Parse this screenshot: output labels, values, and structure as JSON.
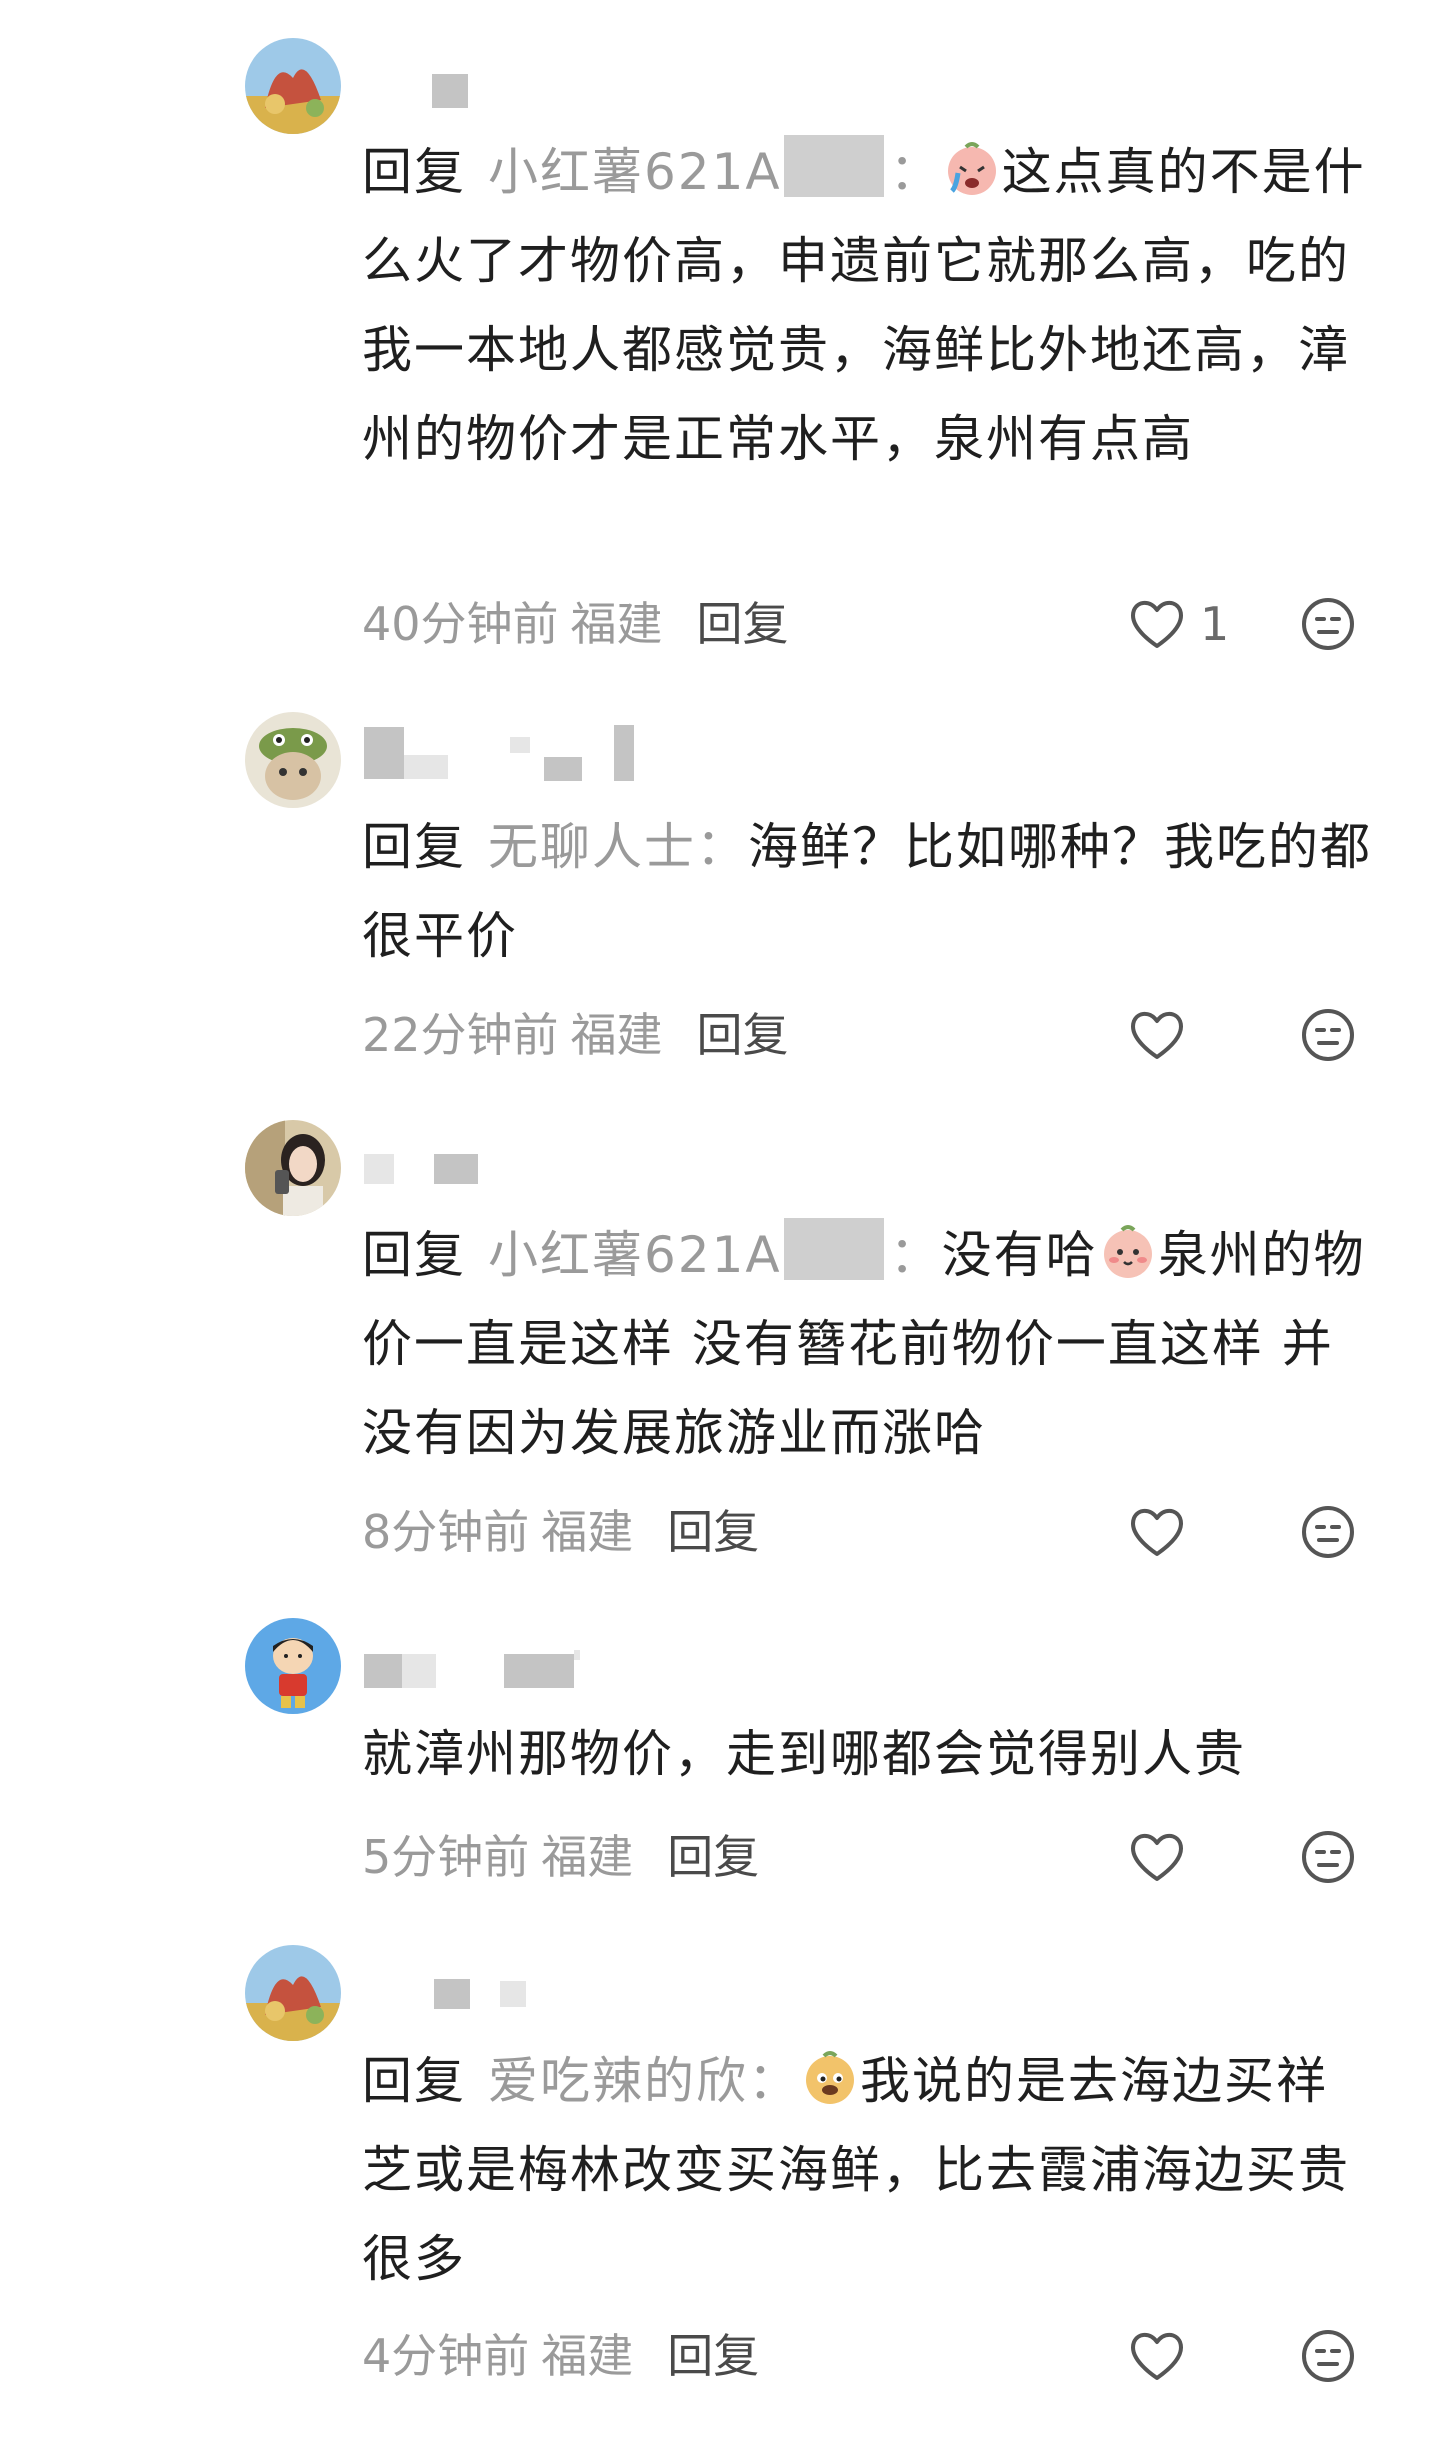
{
  "comments": [
    {
      "reply_label": "回复",
      "reply_target": "小红薯621A",
      "colon": "：",
      "text": "这点真的不是什么火了才物价高，申遗前它就那么高，吃的我一本地人都感觉贵，海鲜比外地还高，漳州的物价才是正常水平，泉州有点高",
      "emoji": "crying-face-icon",
      "time": "40分钟前",
      "region": "福建",
      "reply_button": "回复",
      "likes": "1"
    },
    {
      "reply_label": "回复",
      "reply_target": "无聊人士",
      "colon": "：",
      "text": "海鲜？比如哪种？我吃的都很平价",
      "time": "22分钟前",
      "region": "福建",
      "reply_button": "回复",
      "likes": ""
    },
    {
      "reply_label": "回复",
      "reply_target": "小红薯621A",
      "colon": "：",
      "text_before": "没有哈",
      "emoji": "shy-face-icon",
      "text": "泉州的物价一直是这样 没有簪花前物价一直这样 并没有因为发展旅游业而涨哈",
      "time": "8分钟前",
      "region": "福建",
      "reply_button": "回复",
      "likes": ""
    },
    {
      "text": "就漳州那物价，走到哪都会觉得别人贵",
      "time": "5分钟前",
      "region": "福建",
      "reply_button": "回复",
      "likes": ""
    },
    {
      "reply_label": "回复",
      "reply_target": "爱吃辣的欣",
      "colon": "：",
      "emoji": "smug-face-icon",
      "text": "我说的是去海边买祥芝或是梅林改变买海鲜，比去霞浦海边买贵很多",
      "time": "4分钟前",
      "region": "福建",
      "reply_button": "回复",
      "likes": ""
    }
  ],
  "colors": {
    "text": "#1f1f1f",
    "muted": "#9a9a9a",
    "icon": "#555555"
  }
}
